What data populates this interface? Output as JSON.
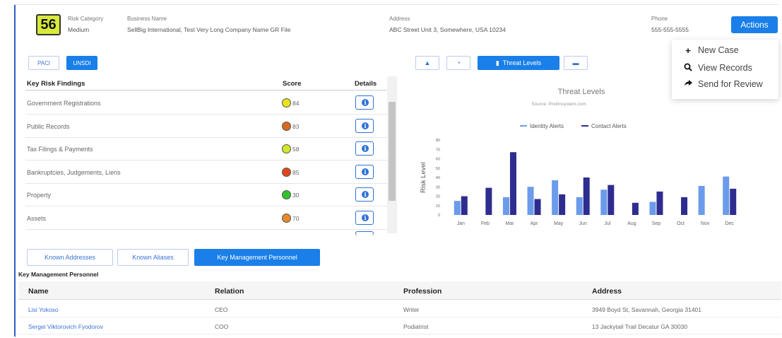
{
  "header": {
    "risk_score": "56",
    "risk_label": "Risk Category",
    "risk_value": "Medium",
    "business_label": "Business Name",
    "business_value": "SellBig International, Test Very Long Company Name GR File",
    "address_label": "Address",
    "address_value": "ABC Street Unit 3, Somewhere, USA 10234",
    "phone_label": "Phone",
    "phone_value": "555-555-5555",
    "actions_label": "Actions"
  },
  "actions_menu": {
    "items": [
      {
        "icon": "plus-icon",
        "label": "New Case"
      },
      {
        "icon": "search-icon",
        "label": "View Records"
      },
      {
        "icon": "share-arrow-icon",
        "label": "Send for Review"
      }
    ]
  },
  "toggles": {
    "pacl": "PACl",
    "unsdi": "UNSDI"
  },
  "findings": {
    "headers": {
      "finding": "Key Risk Findings",
      "score": "Score",
      "details": "Details"
    },
    "rows": [
      {
        "name": "Government Registrations",
        "score": "84",
        "color": "#e7e21a"
      },
      {
        "name": "Public Records",
        "score": "83",
        "color": "#d9691f"
      },
      {
        "name": "Tax Filings & Payments",
        "score": "58",
        "color": "#d3e72a"
      },
      {
        "name": "Bankruptcies, Judgements, Liens",
        "score": "85",
        "color": "#e0471d"
      },
      {
        "name": "Property",
        "score": "30",
        "color": "#30c12f"
      },
      {
        "name": "Assets",
        "score": "70",
        "color": "#e58a2c"
      }
    ]
  },
  "chart_toolbar": {
    "btn1_icon": "thumbs-icon",
    "btn2_icon": "pie-icon",
    "active_label": "Threat Levels",
    "btn4_icon": "bar-chart-icon"
  },
  "chart_data": {
    "type": "bar",
    "title": "Threat Levels",
    "source": "Source: Prelimsystem.com",
    "ylabel": "Risk Level",
    "ylim": [
      0,
      80
    ],
    "yticks": [
      "0",
      "10",
      "20",
      "30",
      "40",
      "50",
      "60",
      "70",
      "80"
    ],
    "categories": [
      "Jan",
      "Feb",
      "Mar",
      "Apr",
      "May",
      "Jun",
      "Jul",
      "Aug",
      "Sep",
      "Oct",
      "Nov",
      "Dec"
    ],
    "series": [
      {
        "name": "Identity Alerts",
        "color": "#6b9bea",
        "values": [
          15,
          null,
          19,
          30,
          37,
          19,
          27,
          null,
          14,
          null,
          31,
          41
        ]
      },
      {
        "name": "Contact Alerts",
        "color": "#2e2d8f",
        "values": [
          20,
          29,
          67,
          17,
          22,
          40,
          32,
          13,
          25,
          19,
          null,
          28
        ]
      }
    ]
  },
  "tabs": {
    "known_addresses": "Known Addresses",
    "known_aliases": "Known Aliases",
    "kmp": "Key Management Personnel"
  },
  "kmp": {
    "title": "Key Management Personnel",
    "headers": {
      "name": "Name",
      "relation": "Relation",
      "profession": "Profession",
      "address": "Address"
    },
    "rows": [
      {
        "name": "Lisi Yokoso",
        "relation": "CEO",
        "profession": "Writer",
        "address": "3949 Boyd St, Savannah, Georgia 31401"
      },
      {
        "name": "Sergei Viktorovich Fyodorov",
        "relation": "COO",
        "profession": "Podiatrist",
        "address": "13 Jackytail Trail Decatur GA 30030"
      }
    ]
  }
}
